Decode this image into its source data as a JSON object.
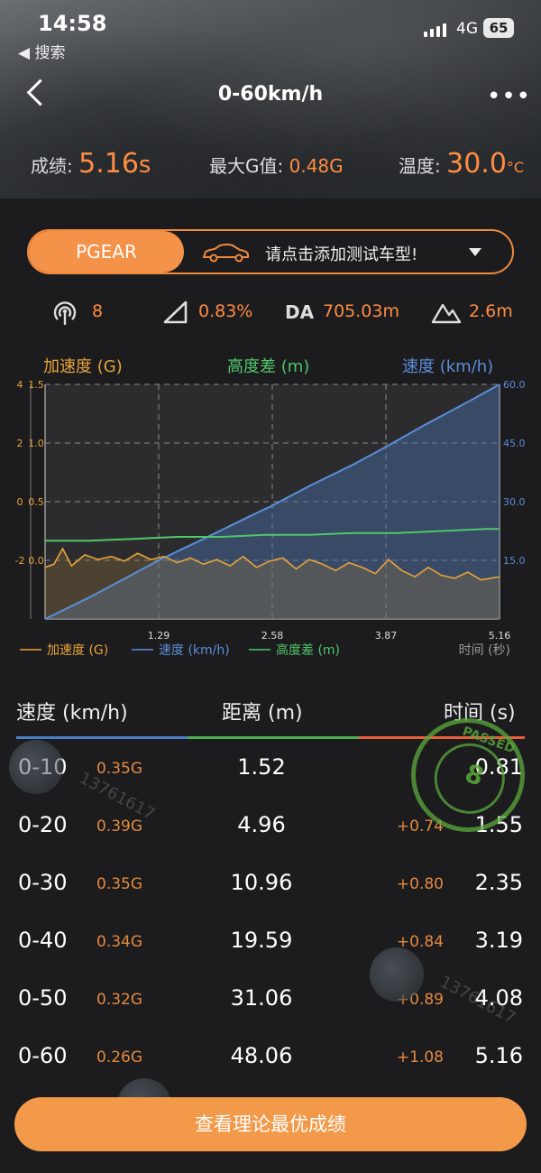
{
  "status_bar": {
    "time": "14:58",
    "back_app": "◀ 搜索",
    "network": "4G",
    "battery": "65"
  },
  "nav": {
    "title": "0-60km/h",
    "more": "•••"
  },
  "stats": {
    "score_label": "成绩:",
    "score_value": "5.16",
    "score_unit": "s",
    "maxg_label": "最大G值:",
    "maxg_value": "0.48G",
    "temp_label": "温度:",
    "temp_value": "30.0",
    "temp_unit": "°C"
  },
  "selector": {
    "brand": "PGEAR",
    "prompt": "请点击添加测试车型!"
  },
  "metrics": {
    "satellites": "8",
    "slope": "0.83%",
    "da_label": "DA",
    "da_value": "705.03m",
    "elevation": "2.6m"
  },
  "colors": {
    "accent": "#f4924a",
    "accel": "#e8a33a",
    "alt": "#4fc76a",
    "speed": "#5b8ed8"
  },
  "chart_data": {
    "type": "line",
    "top_legend": [
      "加速度 (G)",
      "高度差 (m)",
      "速度 (km/h)"
    ],
    "bottom_legend": [
      "加速度 (G)",
      "速度 (km/h)",
      "高度差 (m)"
    ],
    "xlabel": "时间 (秒)",
    "x_ticks": [
      "1.29",
      "2.58",
      "3.87",
      "5.16"
    ],
    "left_ticks_outer": [
      "4",
      "2",
      "0",
      "-2"
    ],
    "left_ticks_inner": [
      "1.5",
      "1.0",
      "0.5",
      "0.0"
    ],
    "right_ticks": [
      "60.0",
      "45.0",
      "30.0",
      "15.0"
    ],
    "xlim": [
      0,
      5.16
    ],
    "series": [
      {
        "name": "速度 (km/h)",
        "axis": "right",
        "ylim": [
          0,
          60
        ],
        "x": [
          0,
          0.5,
          1.0,
          1.29,
          1.8,
          2.3,
          2.58,
          3.0,
          3.5,
          3.87,
          4.3,
          4.8,
          5.16
        ],
        "y": [
          0,
          5.5,
          11.5,
          15,
          20.5,
          26,
          29,
          34,
          39.5,
          44,
          49.5,
          55.5,
          60
        ]
      },
      {
        "name": "高度差 (m)",
        "axis": "left_outer",
        "ylim": [
          -2,
          4
        ],
        "x": [
          0,
          0.5,
          1.0,
          1.5,
          2.0,
          2.5,
          3.0,
          3.5,
          4.0,
          4.5,
          5.0,
          5.16
        ],
        "y": [
          0,
          0,
          0.05,
          0.1,
          0.1,
          0.15,
          0.15,
          0.2,
          0.2,
          0.25,
          0.3,
          0.3
        ]
      },
      {
        "name": "加速度 (G)",
        "axis": "left_inner",
        "ylim": [
          0,
          1.5
        ],
        "x": [
          0,
          0.1,
          0.2,
          0.3,
          0.45,
          0.6,
          0.75,
          0.9,
          1.05,
          1.2,
          1.35,
          1.5,
          1.65,
          1.8,
          1.95,
          2.1,
          2.25,
          2.4,
          2.55,
          2.7,
          2.85,
          3.0,
          3.15,
          3.3,
          3.45,
          3.6,
          3.75,
          3.9,
          4.05,
          4.2,
          4.35,
          4.5,
          4.65,
          4.8,
          4.95,
          5.16
        ],
        "y": [
          0.33,
          0.35,
          0.45,
          0.34,
          0.41,
          0.38,
          0.4,
          0.37,
          0.42,
          0.38,
          0.4,
          0.36,
          0.39,
          0.35,
          0.38,
          0.34,
          0.4,
          0.33,
          0.37,
          0.39,
          0.32,
          0.38,
          0.35,
          0.31,
          0.36,
          0.33,
          0.29,
          0.38,
          0.31,
          0.27,
          0.33,
          0.28,
          0.26,
          0.3,
          0.25,
          0.27
        ]
      }
    ]
  },
  "table": {
    "headers": [
      "速度 (km/h)",
      "距离 (m)",
      "时间 (s)"
    ],
    "rows": [
      {
        "range": "0-10",
        "g": "0.35G",
        "dist": "1.52",
        "delta": "",
        "time": "0.81"
      },
      {
        "range": "0-20",
        "g": "0.39G",
        "dist": "4.96",
        "delta": "+0.74",
        "time": "1.55"
      },
      {
        "range": "0-30",
        "g": "0.35G",
        "dist": "10.96",
        "delta": "+0.80",
        "time": "2.35"
      },
      {
        "range": "0-40",
        "g": "0.34G",
        "dist": "19.59",
        "delta": "+0.84",
        "time": "3.19"
      },
      {
        "range": "0-50",
        "g": "0.32G",
        "dist": "31.06",
        "delta": "+0.89",
        "time": "4.08"
      },
      {
        "range": "0-60",
        "g": "0.26G",
        "dist": "48.06",
        "delta": "+1.08",
        "time": "5.16"
      }
    ]
  },
  "stamp": {
    "text": "PASSED",
    "number": "8"
  },
  "watermark": "13761617",
  "cta": {
    "label": "查看理论最优成绩"
  }
}
